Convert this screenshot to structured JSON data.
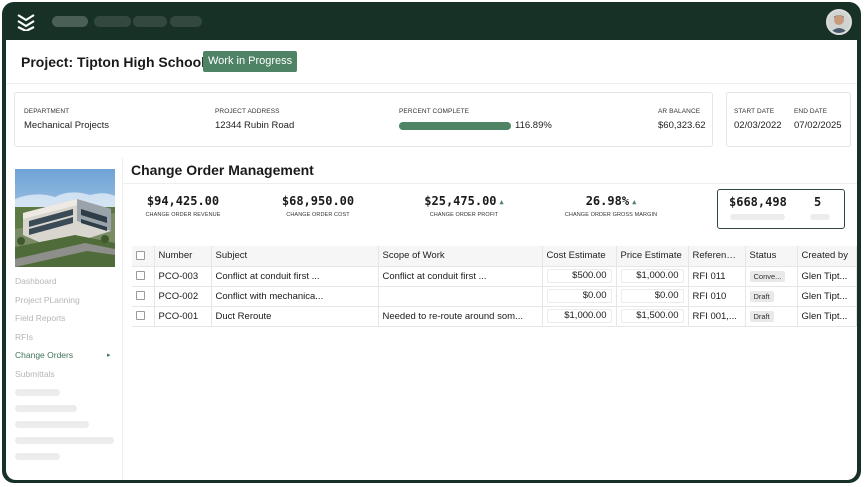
{
  "project": {
    "title": "Project: Tipton High School",
    "status": "Work in Progress",
    "colors": {
      "accent": "#4e8366",
      "frame": "#173126"
    }
  },
  "info": {
    "department_label": "DEPARTMENT",
    "department": "Mechanical Projects",
    "address_label": "PROJECT ADDRESS",
    "address": "12344 Rubin Road",
    "percent_label": "PERCENT COMPLETE",
    "percent": "116.89%",
    "percent_fill": 1.0,
    "ar_label": "AR BALANCE",
    "ar": "$60,323.62",
    "start_label": "START DATE",
    "start": "02/03/2022",
    "end_label": "END DATE",
    "end": "07/02/2025"
  },
  "sidebar": {
    "items": [
      {
        "label": "Dashboard"
      },
      {
        "label": "Project PLanning"
      },
      {
        "label": "Field Reports"
      },
      {
        "label": "RFIs"
      },
      {
        "label": "Change Orders"
      },
      {
        "label": "Submittals"
      }
    ]
  },
  "main": {
    "title": "Change Order Management",
    "metrics": [
      {
        "value": "$94,425.00",
        "label": "CHANGE ORDER REVENUE"
      },
      {
        "value": "$68,950.00",
        "label": "CHANGE ORDER COST"
      },
      {
        "value": "$25,475.00",
        "label": "CHANGE ORDER PROFIT"
      },
      {
        "value": "26.98%",
        "label": "CHANGE ORDER GROSS MARGIN"
      }
    ],
    "summary": {
      "amount": "$668,498",
      "count": "5"
    }
  },
  "table": {
    "headers": [
      "Number",
      "Subject",
      "Scope of Work",
      "Cost Estimate",
      "Price Estimate",
      "References",
      "Status",
      "Created by"
    ],
    "rows": [
      {
        "number": "PCO-003",
        "subject": "Conflict at conduit first ...",
        "scope": "Conflict at conduit first ...",
        "cost": "$500.00",
        "price": "$1,000.00",
        "refs": "RFI 011",
        "status": "Conve...",
        "created": "Glen Tipt..."
      },
      {
        "number": "PCO-002",
        "subject": "Conflict with mechanica...",
        "scope": "",
        "cost": "$0.00",
        "price": "$0.00",
        "refs": "RFI 010",
        "status": "Draft",
        "created": "Glen Tipt..."
      },
      {
        "number": "PCO-001",
        "subject": "Duct Reroute",
        "scope": "Needed to re-route around som...",
        "cost": "$1,000.00",
        "price": "$1,500.00",
        "refs": "RFI 001,...",
        "status": "Draft",
        "created": "Glen Tipt..."
      }
    ]
  }
}
